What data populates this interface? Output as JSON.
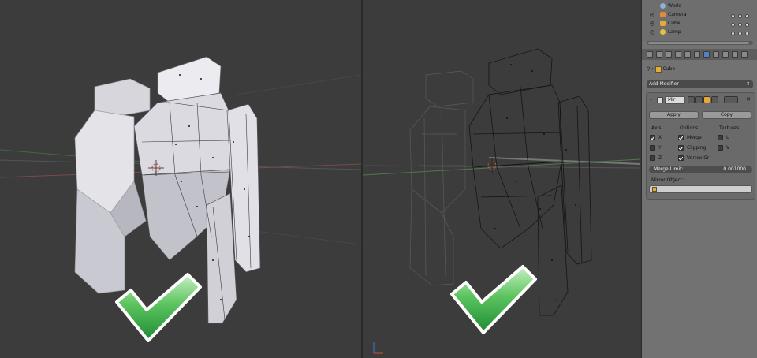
{
  "outliner": {
    "rows": [
      {
        "label": "World",
        "icon": "world-icon",
        "color": "#8fb0d8"
      },
      {
        "label": "Camera",
        "icon": "camera-icon",
        "color": "#e08a3a"
      },
      {
        "label": "Cube",
        "icon": "cube-icon",
        "color": "#e8a93a"
      },
      {
        "label": "Lamp",
        "icon": "lamp-icon",
        "color": "#e8c23a"
      }
    ]
  },
  "context": {
    "breadcrumb_arrow": "›",
    "object": "Cube"
  },
  "modifiers": {
    "add_label": "Add Modifier",
    "add_arrow": "⇕",
    "name": "Mir",
    "apply_label": "Apply",
    "copy_label": "Copy",
    "axis_header": "Axis:",
    "options_header": "Options:",
    "textures_header": "Textures:",
    "axes": [
      {
        "label": "X",
        "checked": true
      },
      {
        "label": "Y",
        "checked": false
      },
      {
        "label": "Z",
        "checked": false
      }
    ],
    "options": [
      {
        "label": "Merge",
        "checked": true
      },
      {
        "label": "Clipping",
        "checked": true
      },
      {
        "label": "Vertex Gr",
        "checked": true
      }
    ],
    "textures": [
      {
        "label": "U",
        "checked": false
      },
      {
        "label": "V",
        "checked": false
      }
    ],
    "merge_limit_label": "Merge Limit:",
    "merge_limit_value": "0.001000",
    "mirror_object_label": "Mirror Object:"
  },
  "colors": {
    "viewport_bg": "#3c3c3c",
    "panel_bg": "#727272",
    "checkmark_green": "#2fa64a",
    "active_tab": "#5680c2"
  }
}
